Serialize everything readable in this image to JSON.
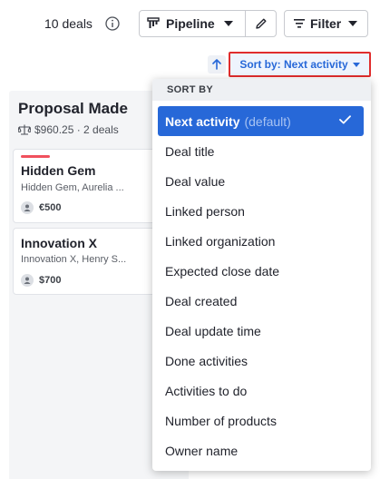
{
  "toolbar": {
    "deal_count": "10 deals",
    "pipeline_label": "Pipeline",
    "filter_label": "Filter",
    "sort_label": "Sort by: Next activity"
  },
  "column": {
    "title": "Proposal Made",
    "summary": "$960.25 · 2 deals",
    "cards": [
      {
        "title": "Hidden Gem",
        "subtitle": "Hidden Gem, Aurelia ...",
        "value": "€500"
      },
      {
        "title": "Innovation X",
        "subtitle": "Innovation X, Henry S...",
        "value": "$700"
      }
    ]
  },
  "sort_menu": {
    "header": "SORT BY",
    "selected_label": "Next activity",
    "selected_suffix": "(default)",
    "items": [
      "Deal title",
      "Deal value",
      "Linked person",
      "Linked organization",
      "Expected close date",
      "Deal created",
      "Deal update time",
      "Done activities",
      "Activities to do",
      "Number of products",
      "Owner name"
    ]
  },
  "colors": {
    "accent": "#2768d8",
    "highlight_border": "#e02d2d",
    "card_flag": "#f0505d"
  },
  "icons": [
    "info-icon",
    "pipeline-icon",
    "pencil-icon",
    "filter-icon",
    "arrow-up-icon",
    "scale-icon",
    "person-icon",
    "checkmark-icon"
  ]
}
